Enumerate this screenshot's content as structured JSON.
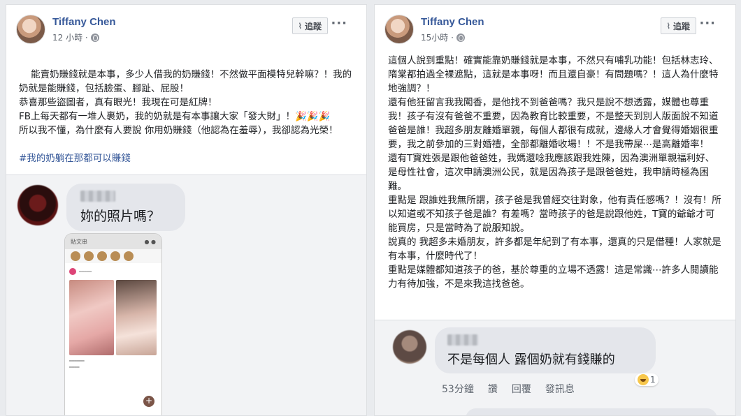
{
  "left_post": {
    "author": "Tiffany Chen",
    "time": "12 小時 ·",
    "follow_label": "追蹤",
    "more_label": "···",
    "body": "能賣奶賺錢就是本事，多少人借我的奶賺錢！不然做平面模特兒幹嘛？！我的奶就是能賺錢，包括臉蛋、腳趾、屁股！\n恭喜那些盜圖者，真有眼光！我現在可是紅牌！\nFB上每天都有一堆人裹奶，我的奶就是有本事讓大家「發大財」！🎉🎉🎉\n所以我不懂，為什麼有人要說 你用奶賺錢（他認為在羞辱），我卻認為光榮！",
    "hashtag": "#我的奶躺在那都可以賺錢",
    "comment": {
      "text": "妳的照片嗎？"
    },
    "screenshot_header": "貼文串"
  },
  "right_post": {
    "author": "Tiffany Chen",
    "time": "15小時 ·",
    "follow_label": "追蹤",
    "more_label": "···",
    "body": "這個人說到重點！確實能靠奶賺錢就是本事，不然只有哺乳功能！包括林志玲、隋棠都拍過全裸遮點，這就是本事呀！而且還自豪！有問題嗎？！這人為什麼特地強調？！\n還有他狂留言我我闖香，是他找不到爸爸嗎？我只是說不想透露，媒體也尊重我！孩子有沒有爸爸不重要，因為教育比較重要，不是整天到別人版面說不知道爸爸是誰！我超多朋友離婚單親，每個人都很有成就，邊緣人才會覺得婚姻很重要，我之前參加的三對婚禮，全部都離婚收場！！不是我帶屎⋯是高離婚率！\n還有T寶姓張是跟他爸爸姓，我媽還唸我應該跟我姓陳，因為澳洲單親福利好、是母性社會，這次申請澳洲公民，就是因為孩子是跟爸爸姓，我申請時極為困難。\n重點是 跟誰姓我無所謂，孩子爸是我曾經交往對象，他有責任感嗎？！沒有！所以知道或不知孩子爸是誰？有差嗎？當時孩子的爸是說跟他姓，T寶的爺爺才可能買房，只是當時為了說服知說。\n說真的 我超多未婚朋友，許多都是年紀到了有本事，還真的只是借種！人家就是有本事，什麼時代了！\n重點是媒體都知道孩子的爸，基於尊重的立場不透露！這是常識⋯許多人閱讀能力有待加強，不是來我這找爸爸。",
    "comment": {
      "text": "不是每個人 露個奶就有錢賺的",
      "time": "53分鐘",
      "like": "讚",
      "reply": "回覆",
      "message": "發訊息",
      "reaction_count": "1"
    }
  }
}
